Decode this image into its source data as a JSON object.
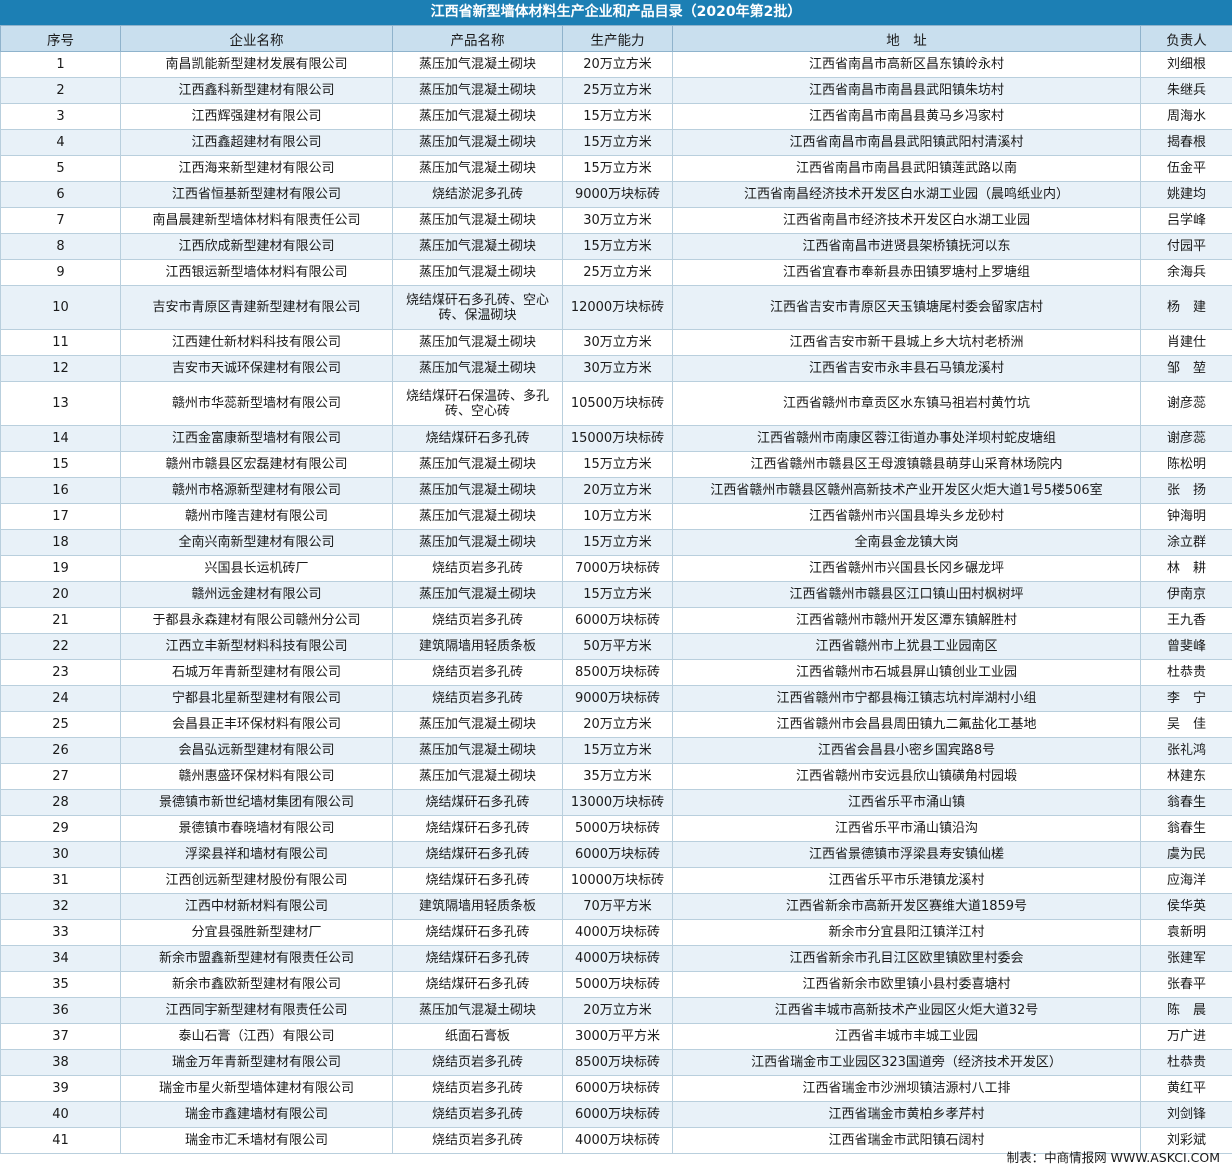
{
  "title": "江西省新型墙体材料生产企业和产品目录（2020年第2批）",
  "headers": [
    "序号",
    "企业名称",
    "产品名称",
    "生产能力",
    "地　址",
    "负责人"
  ],
  "rows": [
    [
      "1",
      "南昌凯能新型建材发展有限公司",
      "蒸压加气混凝土砌块",
      "20万立方米",
      "江西省南昌市高新区昌东镇岭永村",
      "刘细根"
    ],
    [
      "2",
      "江西鑫科新型建材有限公司",
      "蒸压加气混凝土砌块",
      "25万立方米",
      "江西省南昌市南昌县武阳镇朱坊村",
      "朱继兵"
    ],
    [
      "3",
      "江西辉强建材有限公司",
      "蒸压加气混凝土砌块",
      "15万立方米",
      "江西省南昌市南昌县黄马乡冯家村",
      "周海水"
    ],
    [
      "4",
      "江西鑫超建材有限公司",
      "蒸压加气混凝土砌块",
      "15万立方米",
      "江西省南昌市南昌县武阳镇武阳村清溪村",
      "揭春根"
    ],
    [
      "5",
      "江西海来新型建材有限公司",
      "蒸压加气混凝土砌块",
      "15万立方米",
      "江西省南昌市南昌县武阳镇莲武路以南",
      "伍金平"
    ],
    [
      "6",
      "江西省恒基新型建材有限公司",
      "烧结淤泥多孔砖",
      "9000万块标砖",
      "江西省南昌经济技术开发区白水湖工业园（晨鸣纸业内）",
      "姚建均"
    ],
    [
      "7",
      "南昌晨建新型墙体材料有限责任公司",
      "蒸压加气混凝土砌块",
      "30万立方米",
      "江西省南昌市经济技术开发区白水湖工业园",
      "吕学峰"
    ],
    [
      "8",
      "江西欣成新型建材有限公司",
      "蒸压加气混凝土砌块",
      "15万立方米",
      "江西省南昌市进贤县架桥镇抚河以东",
      "付园平"
    ],
    [
      "9",
      "江西银运新型墙体材料有限公司",
      "蒸压加气混凝土砌块",
      "25万立方米",
      "江西省宜春市奉新县赤田镇罗塘村上罗塘组",
      "余海兵"
    ],
    [
      "10",
      "吉安市青原区青建新型建材有限公司",
      "烧结煤矸石多孔砖、空心砖、保温砌块",
      "12000万块标砖",
      "江西省吉安市青原区天玉镇塘尾村委会留家店村",
      "杨　建"
    ],
    [
      "11",
      "江西建仕新材料科技有限公司",
      "蒸压加气混凝土砌块",
      "30万立方米",
      "江西省吉安市新干县城上乡大坑村老桥洲",
      "肖建仕"
    ],
    [
      "12",
      "吉安市天诚环保建材有限公司",
      "蒸压加气混凝土砌块",
      "30万立方米",
      "江西省吉安市永丰县石马镇龙溪村",
      "邹　堃"
    ],
    [
      "13",
      "赣州市华蕊新型墙材有限公司",
      "烧结煤矸石保温砖、多孔砖、空心砖",
      "10500万块标砖",
      "江西省赣州市章贡区水东镇马祖岩村黄竹坑",
      "谢彦蕊"
    ],
    [
      "14",
      "江西金富康新型墙材有限公司",
      "烧结煤矸石多孔砖",
      "15000万块标砖",
      "江西省赣州市南康区蓉江街道办事处洋坝村蛇皮塘组",
      "谢彦蕊"
    ],
    [
      "15",
      "赣州市赣县区宏磊建材有限公司",
      "蒸压加气混凝土砌块",
      "15万立方米",
      "江西省赣州市赣县区王母渡镇赣县萌芽山采育林场院内",
      "陈松明"
    ],
    [
      "16",
      "赣州市格源新型建材有限公司",
      "蒸压加气混凝土砌块",
      "20万立方米",
      "江西省赣州市赣县区赣州高新技术产业开发区火炬大道1号5楼506室",
      "张　扬"
    ],
    [
      "17",
      "赣州市隆吉建材有限公司",
      "蒸压加气混凝土砌块",
      "10万立方米",
      "江西省赣州市兴国县埠头乡龙砂村",
      "钟海明"
    ],
    [
      "18",
      "全南兴南新型建材有限公司",
      "蒸压加气混凝土砌块",
      "15万立方米",
      "全南县金龙镇大岗",
      "涂立群"
    ],
    [
      "19",
      "兴国县长运机砖厂",
      "烧结页岩多孔砖",
      "7000万块标砖",
      "江西省赣州市兴国县长冈乡碾龙坪",
      "林　耕"
    ],
    [
      "20",
      "赣州远金建材有限公司",
      "蒸压加气混凝土砌块",
      "15万立方米",
      "江西省赣州市赣县区江口镇山田村枫树坪",
      "伊南京"
    ],
    [
      "21",
      "于都县永森建材有限公司赣州分公司",
      "烧结页岩多孔砖",
      "6000万块标砖",
      "江西省赣州市赣州开发区潭东镇解胜村",
      "王九香"
    ],
    [
      "22",
      "江西立丰新型材料科技有限公司",
      "建筑隔墙用轻质条板",
      "50万平方米",
      "江西省赣州市上犹县工业园南区",
      "曾斐峰"
    ],
    [
      "23",
      "石城万年青新型建材有限公司",
      "烧结页岩多孔砖",
      "8500万块标砖",
      "江西省赣州市石城县屏山镇创业工业园",
      "杜恭贵"
    ],
    [
      "24",
      "宁都县北星新型建材有限公司",
      "烧结页岩多孔砖",
      "9000万块标砖",
      "江西省赣州市宁都县梅江镇志坑村岸湖村小组",
      "李　宁"
    ],
    [
      "25",
      "会昌县正丰环保材料有限公司",
      "蒸压加气混凝土砌块",
      "20万立方米",
      "江西省赣州市会昌县周田镇九二氟盐化工基地",
      "吴　佳"
    ],
    [
      "26",
      "会昌弘远新型建材有限公司",
      "蒸压加气混凝土砌块",
      "15万立方米",
      "江西省会昌县小密乡国宾路8号",
      "张礼鸿"
    ],
    [
      "27",
      "赣州惠盛环保材料有限公司",
      "蒸压加气混凝土砌块",
      "35万立方米",
      "江西省赣州市安远县欣山镇磺角村园塅",
      "林建东"
    ],
    [
      "28",
      "景德镇市新世纪墙材集团有限公司",
      "烧结煤矸石多孔砖",
      "13000万块标砖",
      "江西省乐平市涌山镇",
      "翁春生"
    ],
    [
      "29",
      "景德镇市春晓墙材有限公司",
      "烧结煤矸石多孔砖",
      "5000万块标砖",
      "江西省乐平市涌山镇沿沟",
      "翁春生"
    ],
    [
      "30",
      "浮梁县祥和墙材有限公司",
      "烧结煤矸石多孔砖",
      "6000万块标砖",
      "江西省景德镇市浮梁县寿安镇仙槎",
      "虞为民"
    ],
    [
      "31",
      "江西创远新型建材股份有限公司",
      "烧结煤矸石多孔砖",
      "10000万块标砖",
      "江西省乐平市乐港镇龙溪村",
      "应海洋"
    ],
    [
      "32",
      "江西中材新材料有限公司",
      "建筑隔墙用轻质条板",
      "70万平方米",
      "江西省新余市高新开发区赛维大道1859号",
      "侯华英"
    ],
    [
      "33",
      "分宜县强胜新型建材厂",
      "烧结煤矸石多孔砖",
      "4000万块标砖",
      "新余市分宜县阳江镇洋江村",
      "袁新明"
    ],
    [
      "34",
      "新余市盟鑫新型建材有限责任公司",
      "烧结煤矸石多孔砖",
      "4000万块标砖",
      "江西省新余市孔目江区欧里镇欧里村委会",
      "张建军"
    ],
    [
      "35",
      "新余市鑫欧新型建材有限公司",
      "烧结煤矸石多孔砖",
      "5000万块标砖",
      "江西省新余市欧里镇小县村委喜塘村",
      "张春平"
    ],
    [
      "36",
      "江西同宇新型建材有限责任公司",
      "蒸压加气混凝土砌块",
      "20万立方米",
      "江西省丰城市高新技术产业园区火炬大道32号",
      "陈　晨"
    ],
    [
      "37",
      "泰山石膏（江西）有限公司",
      "纸面石膏板",
      "3000万平方米",
      "江西省丰城市丰城工业园",
      "万广进"
    ],
    [
      "38",
      "瑞金万年青新型建材有限公司",
      "烧结页岩多孔砖",
      "8500万块标砖",
      "江西省瑞金市工业园区323国道旁（经济技术开发区）",
      "杜恭贵"
    ],
    [
      "39",
      "瑞金市星火新型墙体建材有限公司",
      "烧结页岩多孔砖",
      "6000万块标砖",
      "江西省瑞金市沙洲坝镇洁源村八工排",
      "黄红平"
    ],
    [
      "40",
      "瑞金市鑫建墙材有限公司",
      "烧结页岩多孔砖",
      "6000万块标砖",
      "江西省瑞金市黄柏乡孝芹村",
      "刘剑锋"
    ],
    [
      "41",
      "瑞金市汇禾墙材有限公司",
      "烧结页岩多孔砖",
      "4000万块标砖",
      "江西省瑞金市武阳镇石阔村",
      "刘彩斌"
    ]
  ],
  "footer": "制表：中商情报网 WWW.ASKCI.COM"
}
